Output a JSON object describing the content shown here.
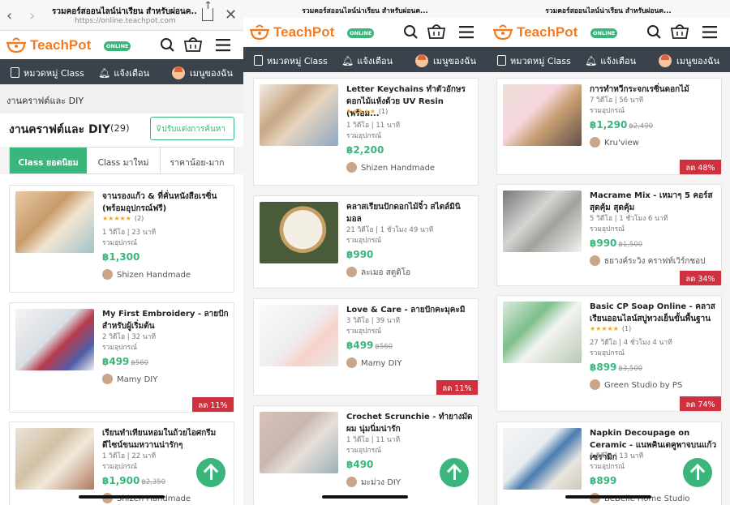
{
  "browser": {
    "title": "รวมคอร์สออนไลน์น่าเรียน สำหรับผ่อนค...",
    "url": "https://online.teachpot.com",
    "strip_title": "รวมคอร์สออนไลน์น่าเรียน สำหรับผ่อนค..."
  },
  "brand": {
    "name": "TeachPot",
    "badge": "ONLINE",
    "accent": "#f47b20",
    "green": "#3ab57c",
    "nav_bg": "#3a424b",
    "discount_red": "#d0313f"
  },
  "nav": {
    "category": "หมวดหมู่ Class",
    "notify": "แจ้งเตือน",
    "mymenu": "เมนูของฉัน"
  },
  "page": {
    "breadcrumb": "งานคราฟต์และ DIY",
    "title": "งานคราฟต์และ DIY",
    "count": "(29)",
    "filter": "ปรับแต่งการค้นหา",
    "sort": [
      "Class ยอดนิยม",
      "Class มาใหม่",
      "ราคาน้อย-มาก"
    ]
  },
  "panel1": [
    {
      "title": "จานรองแก้ว & ที่คั่นหนังสือเรซิ่น (พร้อมอุปกรณ์ฟรี)",
      "stars": "★★★★★",
      "reviews": "(2)",
      "meta1": "1 วิดีโอ | 23 นาที",
      "meta2": "รวมอุปกรณ์",
      "price": "฿1,300",
      "old": "",
      "author": "Shizen Handmade",
      "discount": ""
    },
    {
      "title": "My First Embroidery - ลายปักสำหรับผู้เริ่มต้น",
      "stars": "",
      "reviews": "",
      "meta1": "2 วิดีโอ | 32 นาที",
      "meta2": "รวมอุปกรณ์",
      "price": "฿499",
      "old": "฿560",
      "author": "Mamy DIY",
      "discount": "ลด 11%"
    },
    {
      "title": "เรียนทำเทียนหอมในถ้วยไอศกรีม ดีไซน์ขนมหวานน่ารักๆ",
      "stars": "",
      "reviews": "",
      "meta1": "1 วิดีโอ | 22 นาที",
      "meta2": "รวมอุปกรณ์",
      "price": "฿1,900",
      "old": "฿2,350",
      "author": "Shizen Handmade",
      "discount": ""
    }
  ],
  "panel2": [
    {
      "title": "Letter Keychains ทำตัวอักษรดอกไม้แห้งด้วย UV Resin (พร้อม...",
      "stars": "★★★★★",
      "reviews": "(1)",
      "meta1": "1 วิดีโอ | 11 นาที",
      "meta2": "รวมอุปกรณ์",
      "price": "฿2,200",
      "old": "",
      "author": "Shizen Handmade",
      "discount": ""
    },
    {
      "title": "คลาสเรียนปักดอกไม้จิ๋ว สไตล์มินิมอล",
      "stars": "",
      "reviews": "",
      "meta1": "21 วิดีโอ | 1 ชั่วโมง 49 นาที",
      "meta2": "รวมอุปกรณ์",
      "price": "฿990",
      "old": "",
      "author": "ละเมอ สตูดิโอ",
      "discount": ""
    },
    {
      "title": "Love & Care - ลายปักคะมุคะมิ",
      "stars": "",
      "reviews": "",
      "meta1": "3 วิดีโอ | 39 นาที",
      "meta2": "รวมอุปกรณ์",
      "price": "฿499",
      "old": "฿560",
      "author": "Mamy DIY",
      "discount": "ลด 11%"
    },
    {
      "title": "Crochet Scrunchie - ทำยางมัดผม นุ่มนิ่มน่ารัก",
      "stars": "",
      "reviews": "",
      "meta1": "1 วิดีโอ | 11 นาที",
      "meta2": "รวมอุปกรณ์",
      "price": "฿490",
      "old": "",
      "author": "มะม่วง DIY",
      "discount": ""
    }
  ],
  "panel3": [
    {
      "title": "การทำหวีกระจกเรซิ่นดอกไม้",
      "stars": "",
      "reviews": "",
      "meta1": "7 วิดีโอ | 56 นาที",
      "meta2": "รวมอุปกรณ์",
      "price": "฿1,290",
      "old": "฿2,490",
      "author": "Kru'view",
      "discount": "ลด 48%"
    },
    {
      "title": "Macrame Mix - เหมาๆ 5 คอร์สสุดคุ้ม สุดคุ้ม",
      "stars": "",
      "reviews": "",
      "meta1": "5 วิดีโอ | 1 ชั่วโมง 6 นาที",
      "meta2": "รวมอุปกรณ์",
      "price": "฿990",
      "old": "฿1,500",
      "author": "ธยางค์ระวิง คราฟท์เวิร์กชอป",
      "discount": "ลด 34%"
    },
    {
      "title": "Basic CP Soap Online - คลาสเรียนออนไลน์สบู่ทวงเย็นขั้นพื้นฐาน",
      "stars": "★★★★★",
      "reviews": "(1)",
      "meta1": "27 วิดีโอ | 4 ชั่วโมง 4 นาที",
      "meta2": "รวมอุปกรณ์",
      "price": "฿899",
      "old": "฿3,500",
      "author": "Green Studio by PS",
      "discount": "ลด 74%"
    },
    {
      "title": "Napkin Decoupage on Ceramic - แนพคินเดคูพาจบนแก้วเซรามิก",
      "stars": "",
      "reviews": "",
      "meta1": "1 วิดีโอ | 13 นาที",
      "meta2": "รวมอุปกรณ์",
      "price": "฿899",
      "old": "",
      "author": "BeBelle Home Studio",
      "discount": ""
    }
  ]
}
